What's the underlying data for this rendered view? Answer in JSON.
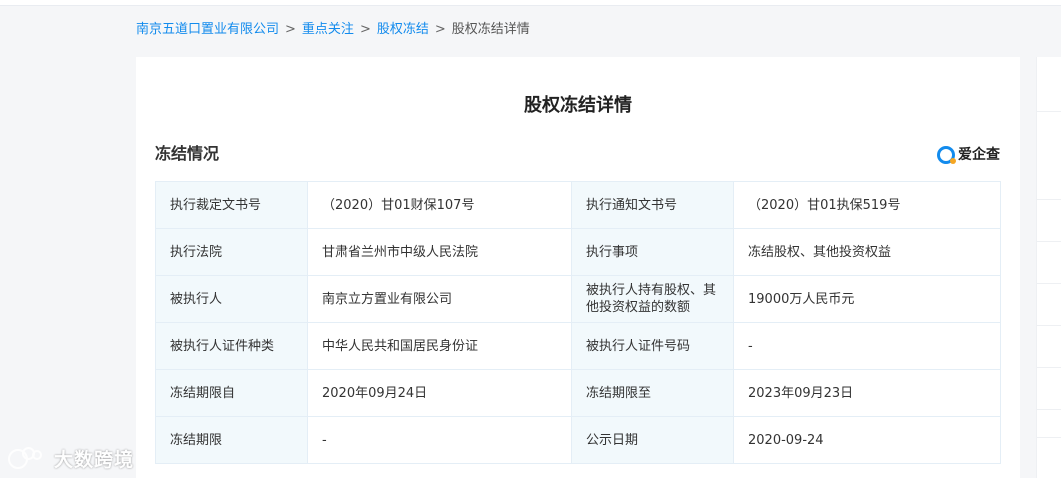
{
  "breadcrumb": {
    "items": [
      "南京五道口置业有限公司",
      "重点关注",
      "股权冻结"
    ],
    "separator": ">",
    "current": "股权冻结详情"
  },
  "page": {
    "title": "股权冻结详情",
    "section_title": "冻结情况"
  },
  "brand": {
    "name": "爱企查",
    "icon": "search-magnifier-logo-icon"
  },
  "table": {
    "rows": [
      {
        "label1": "执行裁定文书号",
        "value1": "（2020）甘01财保107号",
        "label2": "执行通知文书号",
        "value2": "（2020）甘01执保519号"
      },
      {
        "label1": "执行法院",
        "value1": "甘肃省兰州市中级人民法院",
        "label2": "执行事项",
        "value2": "冻结股权、其他投资权益"
      },
      {
        "label1": "被执行人",
        "value1": "南京立方置业有限公司",
        "label2": "被执行人持有股权、其他投资权益的数额",
        "value2": "19000万人民币元"
      },
      {
        "label1": "被执行人证件种类",
        "value1": "中华人民共和国居民身份证",
        "label2": "被执行人证件号码",
        "value2": "-"
      },
      {
        "label1": "冻结期限自",
        "value1": "2020年09月24日",
        "label2": "冻结期限至",
        "value2": "2023年09月23日"
      },
      {
        "label1": "冻结期限",
        "value1": "-",
        "label2": "公示日期",
        "value2": "2020-09-24"
      }
    ]
  },
  "watermark": {
    "text": "大数跨境",
    "icon": "chat-bubble-logo-icon"
  },
  "colors": {
    "link": "#128bed",
    "label_bg": "#f2f9fc",
    "border": "#e4eef6",
    "page_bg": "#f5f6f8"
  }
}
